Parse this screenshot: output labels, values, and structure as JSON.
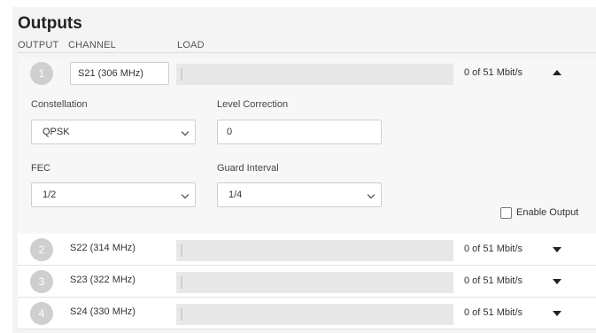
{
  "title": "Outputs",
  "columns": {
    "output": "OUTPUT",
    "channel": "CHANNEL",
    "load": "LOAD"
  },
  "outputs": [
    {
      "number": "1",
      "channel": "S21 (306 MHz)",
      "load_text": "0 of 51 Mbit/s",
      "load_fraction": 0,
      "expanded": true
    },
    {
      "number": "2",
      "channel": "S22 (314 MHz)",
      "load_text": "0 of 51 Mbit/s",
      "load_fraction": 0,
      "expanded": false
    },
    {
      "number": "3",
      "channel": "S23 (322 MHz)",
      "load_text": "0 of 51 Mbit/s",
      "load_fraction": 0,
      "expanded": false
    },
    {
      "number": "4",
      "channel": "S24 (330 MHz)",
      "load_text": "0 of 51 Mbit/s",
      "load_fraction": 0,
      "expanded": false
    }
  ],
  "settings": {
    "constellation_label": "Constellation",
    "constellation_value": "QPSK",
    "level_correction_label": "Level Correction",
    "level_correction_value": "0",
    "fec_label": "FEC",
    "fec_value": "1/2",
    "guard_interval_label": "Guard Interval",
    "guard_interval_value": "1/4",
    "enable_output_label": "Enable Output",
    "enable_output_checked": false
  },
  "icons": {
    "expanded": "chevron-up-icon",
    "collapsed": "chevron-down-icon",
    "select": "chevron-down-icon"
  }
}
